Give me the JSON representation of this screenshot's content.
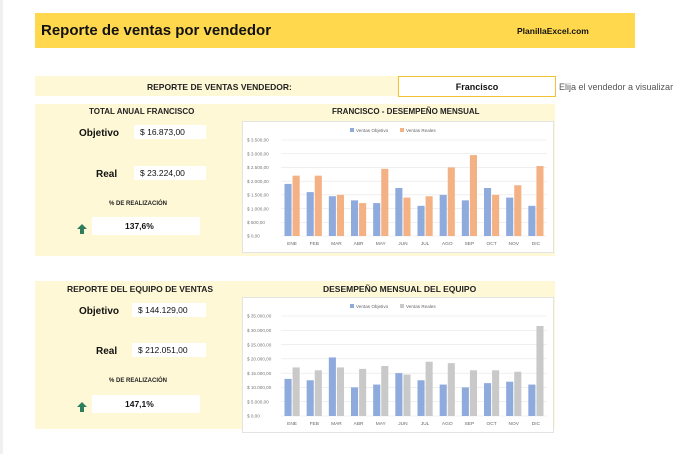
{
  "header": {
    "title": "Reporte de ventas por vendedor",
    "brand": "PlanillaExcel.com"
  },
  "selector": {
    "label": "REPORTE DE VENTAS VENDEDOR:",
    "value": "Francisco",
    "hint": "Elija el vendedor a visualizar"
  },
  "seller_panel": {
    "title": "TOTAL ANUAL FRANCISCO",
    "objetivo_label": "Objetivo",
    "objetivo_value": "$ 16.873,00",
    "real_label": "Real",
    "real_value": "$ 23.224,00",
    "pct_label": "% DE REALIZACIÓN",
    "pct_value": "137,6%"
  },
  "team_panel": {
    "title": "REPORTE DEL EQUIPO DE VENTAS",
    "objetivo_label": "Objetivo",
    "objetivo_value": "$ 144.129,00",
    "real_label": "Real",
    "real_value": "$ 212.051,00",
    "pct_label": "% DE REALIZACIÓN",
    "pct_value": "147,1%"
  },
  "colors": {
    "accent": "#ffd84d",
    "band": "#fff8d6",
    "arrow": "#2e7d5b"
  },
  "chart_data": [
    {
      "type": "bar",
      "title": "FRANCISCO - DESEMPEÑO MENSUAL",
      "categories": [
        "ENE",
        "FEB",
        "MAR",
        "ABR",
        "MAY",
        "JUN",
        "JUL",
        "AGO",
        "SEP",
        "OCT",
        "NOV",
        "DIC"
      ],
      "series": [
        {
          "name": "Ventas Objetivo",
          "color": "#8faadc",
          "values": [
            1900,
            1600,
            1450,
            1300,
            1200,
            1750,
            1100,
            1500,
            1300,
            1750,
            1400,
            1100
          ]
        },
        {
          "name": "Ventas Reales",
          "color": "#f4b183",
          "values": [
            2200,
            2200,
            1500,
            1200,
            2450,
            1400,
            1450,
            2500,
            2950,
            1500,
            1850,
            2550
          ]
        }
      ],
      "ylim": [
        0,
        3500
      ],
      "yticks": [
        "$ 0,00",
        "$ 500,00",
        "$ 1.000,00",
        "$ 1.500,00",
        "$ 2.000,00",
        "$ 2.500,00",
        "$ 3.000,00",
        "$ 3.500,00"
      ],
      "legend": "top",
      "grid": true
    },
    {
      "type": "bar",
      "title": "DESEMPEÑO MENSUAL DEL EQUIPO",
      "categories": [
        "ENE",
        "FEB",
        "MAR",
        "ABR",
        "MAY",
        "JUN",
        "JUL",
        "AGO",
        "SEP",
        "OCT",
        "NOV",
        "DIC"
      ],
      "series": [
        {
          "name": "Ventas Objetivo",
          "color": "#8faadc",
          "values": [
            13000,
            12500,
            20500,
            10000,
            11000,
            15000,
            12500,
            11000,
            10000,
            11500,
            12000,
            11000
          ]
        },
        {
          "name": "Ventas Reales",
          "color": "#c9c9c9",
          "values": [
            17000,
            16000,
            17000,
            16500,
            17500,
            14500,
            19000,
            18500,
            16000,
            16000,
            15500,
            31500
          ]
        }
      ],
      "ylim": [
        0,
        35000
      ],
      "yticks": [
        "$ 0,00",
        "$ 5.000,00",
        "$ 10.000,00",
        "$ 15.000,00",
        "$ 20.000,00",
        "$ 25.000,00",
        "$ 30.000,00",
        "$ 35.000,00"
      ],
      "legend": "top",
      "grid": true
    }
  ]
}
